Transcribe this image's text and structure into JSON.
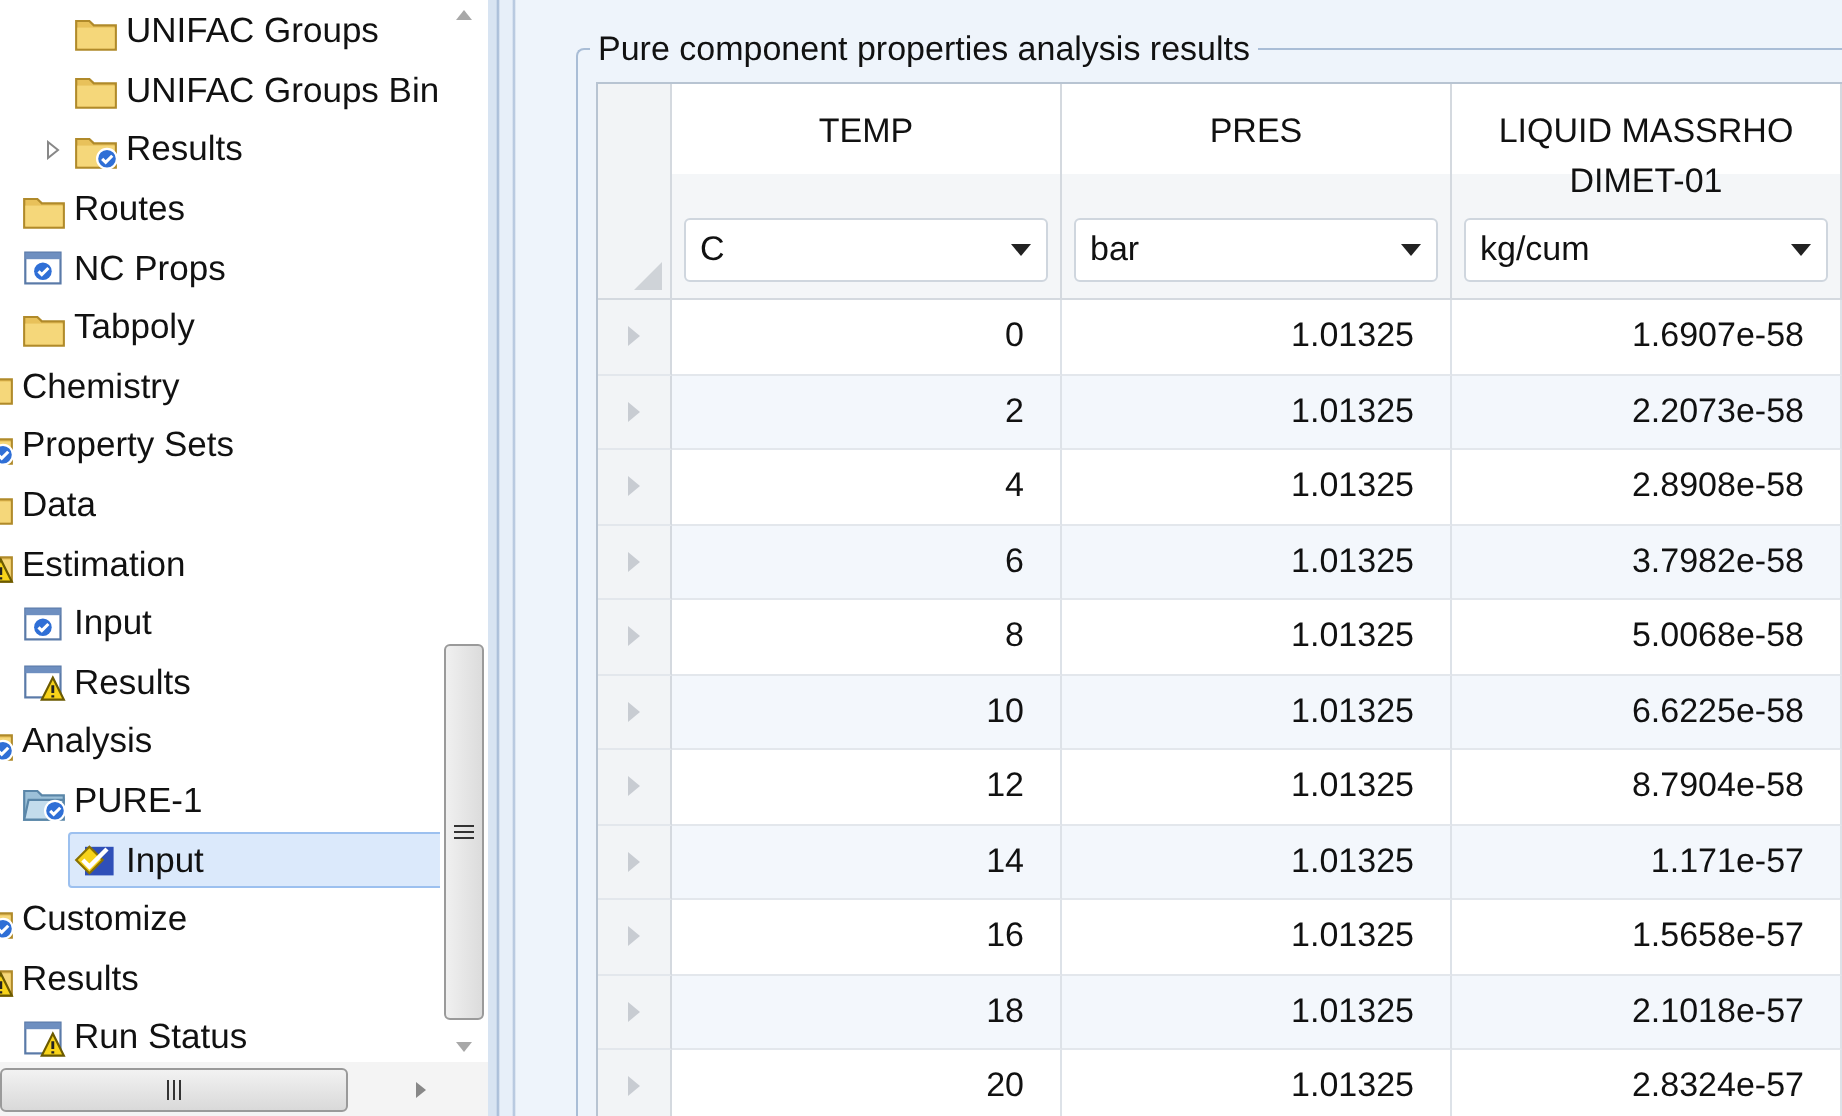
{
  "tree": [
    {
      "children": [
        {
          "children": [
            {
              "label": "UNIFAC Groups",
              "kind": "folder",
              "selected": false
            },
            {
              "label": "UNIFAC Groups Bin",
              "kind": "folder",
              "selected": false
            },
            {
              "label": "Results",
              "kind": "folder_check",
              "selected": false,
              "expanded": false
            }
          ]
        },
        {
          "label": "Routes",
          "kind": "folder",
          "selected": false
        },
        {
          "label": "NC Props",
          "kind": "form_check",
          "selected": false
        },
        {
          "label": "Tabpoly",
          "kind": "folder",
          "selected": false
        }
      ]
    },
    {
      "label": "Chemistry",
      "kind": "folder",
      "selected": false
    },
    {
      "label": "Property Sets",
      "kind": "folder_check",
      "selected": false
    },
    {
      "label": "Data",
      "kind": "folder",
      "selected": false
    },
    {
      "label": "Estimation",
      "kind": "folder_warning",
      "selected": false,
      "children": [
        {
          "label": "Input",
          "kind": "form_check",
          "selected": false
        },
        {
          "label": "Results",
          "kind": "form_warning",
          "selected": false
        }
      ]
    },
    {
      "label": "Analysis",
      "kind": "folder_check",
      "selected": false,
      "children": [
        {
          "label": "PURE-1",
          "kind": "folder_open_check",
          "selected": false,
          "children": [
            {
              "label": "Input",
              "kind": "form_selected",
              "selected": true
            }
          ]
        }
      ]
    },
    {
      "label": "Customize",
      "kind": "folder_check",
      "selected": false
    },
    {
      "label": "Results",
      "kind": "folder_warning",
      "selected": false,
      "children": [
        {
          "label": "Run Status",
          "kind": "form_warning",
          "selected": false
        }
      ]
    }
  ],
  "group_title": "Pure component properties analysis results",
  "table": {
    "columns": [
      {
        "heading": "TEMP",
        "unit": "C"
      },
      {
        "heading": "PRES",
        "unit": "bar"
      },
      {
        "heading": "LIQUID MASSRHO DIMET-01",
        "unit": "kg/cum"
      }
    ],
    "rows": [
      [
        "0",
        "1.01325",
        "1.6907e-58"
      ],
      [
        "2",
        "1.01325",
        "2.2073e-58"
      ],
      [
        "4",
        "1.01325",
        "2.8908e-58"
      ],
      [
        "6",
        "1.01325",
        "3.7982e-58"
      ],
      [
        "8",
        "1.01325",
        "5.0068e-58"
      ],
      [
        "10",
        "1.01325",
        "6.6225e-58"
      ],
      [
        "12",
        "1.01325",
        "8.7904e-58"
      ],
      [
        "14",
        "1.01325",
        "1.171e-57"
      ],
      [
        "16",
        "1.01325",
        "1.5658e-57"
      ],
      [
        "18",
        "1.01325",
        "2.1018e-57"
      ],
      [
        "20",
        "1.01325",
        "2.8324e-57"
      ]
    ]
  }
}
